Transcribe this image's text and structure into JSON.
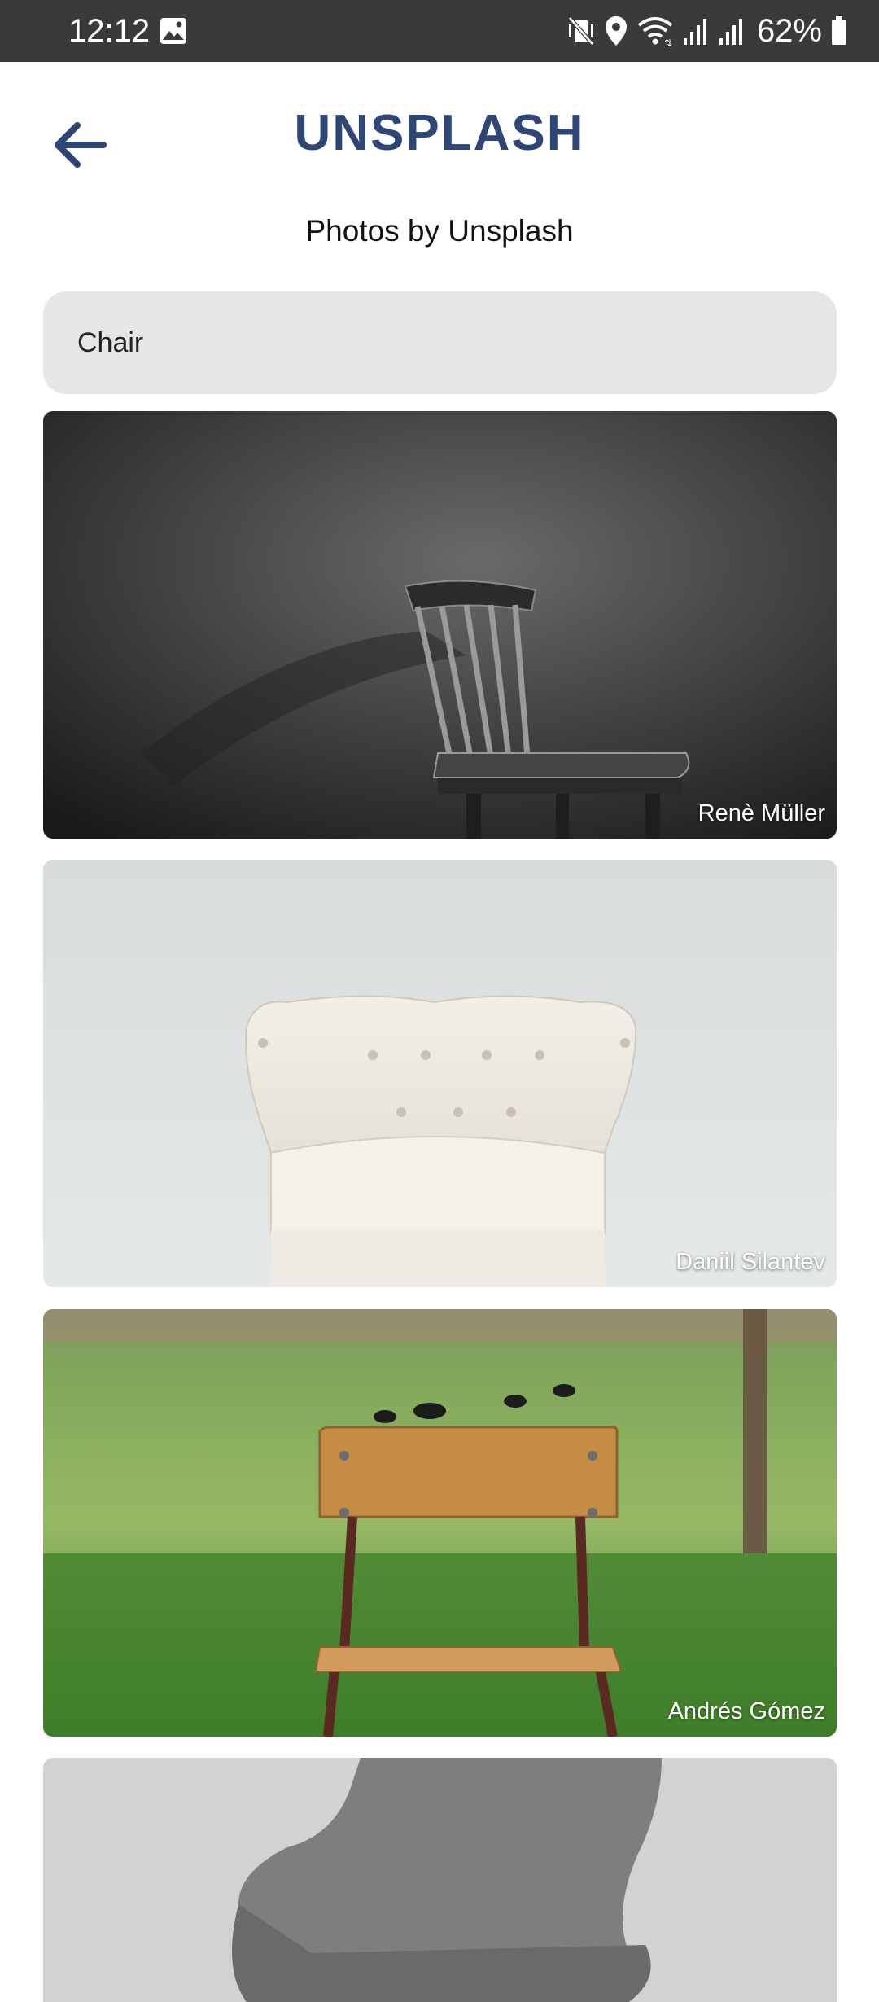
{
  "status_bar": {
    "time": "12:12",
    "battery": "62%",
    "icons": [
      "gallery-icon",
      "vibrate-off-icon",
      "location-icon",
      "wifi-icon",
      "signal-icon",
      "signal-icon",
      "battery-icon"
    ]
  },
  "header": {
    "back_icon": "arrow-left-icon",
    "title": "UNSPLASH",
    "title_color": "#2e4675"
  },
  "subtitle": "Photos by Unsplash",
  "search": {
    "value": "Chair"
  },
  "photos": [
    {
      "credit": "Renè Müller",
      "description_icon": "photo-dark-wooden-chair"
    },
    {
      "credit": "Daniil Silantev",
      "description_icon": "photo-white-tufted-armchair"
    },
    {
      "credit": "Andrés Gómez",
      "description_icon": "photo-school-chair-on-grass"
    },
    {
      "credit": "",
      "description_icon": "photo-grey-fabric-chair"
    }
  ]
}
